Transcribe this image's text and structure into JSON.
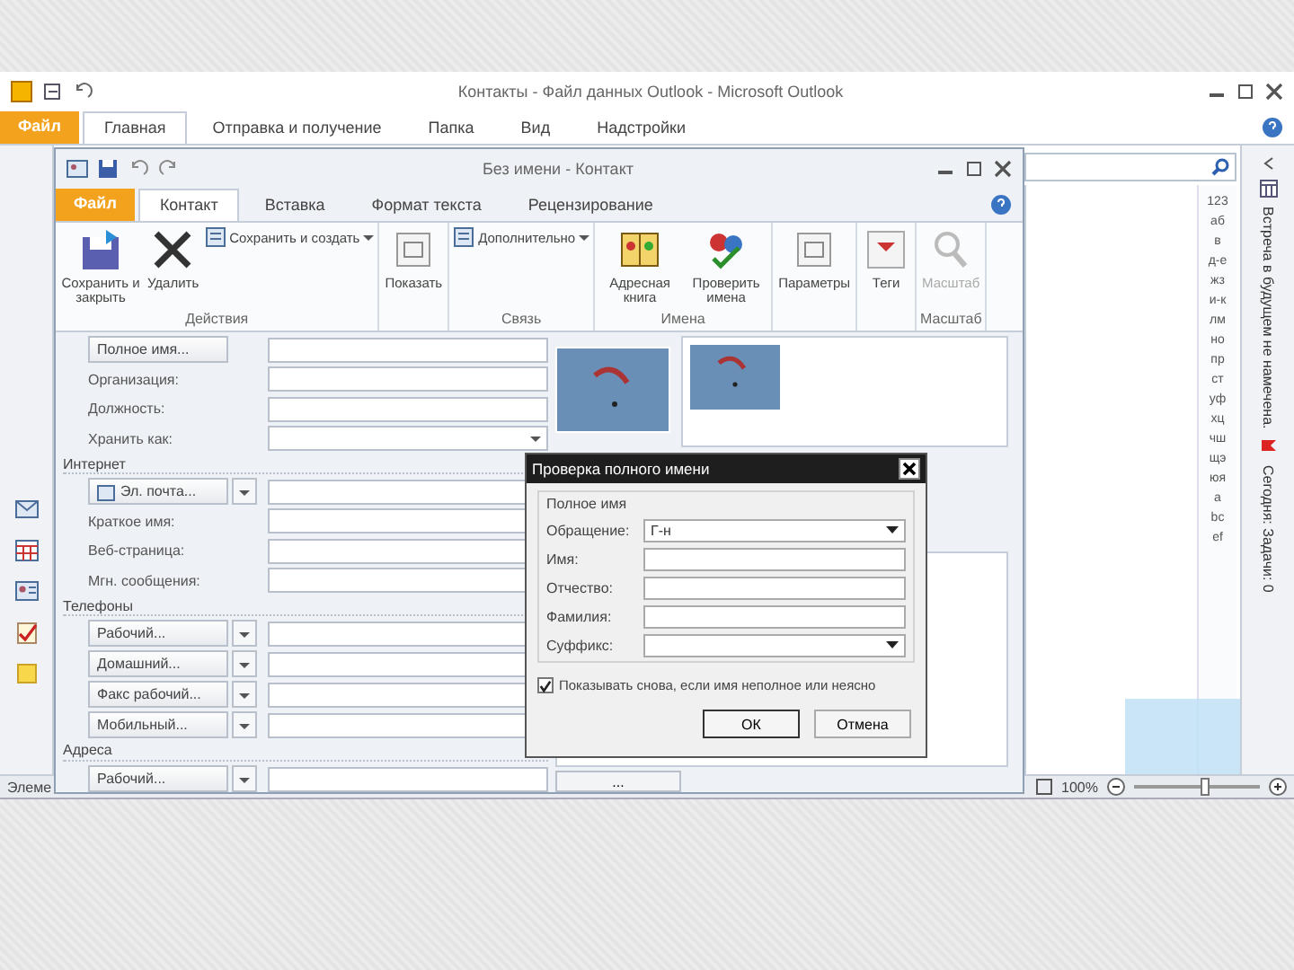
{
  "main_window": {
    "title": "Контакты - Файл данных Outlook - Microsoft Outlook",
    "menu_tabs": [
      {
        "label": "Файл",
        "selected": false,
        "kind": "file"
      },
      {
        "label": "Главная",
        "selected": true,
        "kind": "tab"
      },
      {
        "label": "Отправка и получение",
        "selected": false,
        "kind": "tab"
      },
      {
        "label": "Папка",
        "selected": false,
        "kind": "tab"
      },
      {
        "label": "Вид",
        "selected": false,
        "kind": "tab"
      },
      {
        "label": "Надстройки",
        "selected": false,
        "kind": "tab"
      }
    ],
    "status_text": "Элеме",
    "zoom_label": "100%",
    "zoom": {
      "level": 0.55
    }
  },
  "index_letters": [
    "123",
    "аб",
    "в",
    "д-е",
    "жз",
    "и-к",
    "лм",
    "но",
    "пр",
    "ст",
    "уф",
    "хц",
    "чш",
    "щэ",
    "юя",
    "a",
    "bc",
    "ef"
  ],
  "todo_bar": {
    "appointments": "Встреча в будущем не намечена.",
    "tasks": "Сегодня: Задачи: 0"
  },
  "contact_window": {
    "title": "Без имени - Контакт",
    "tabs": [
      {
        "label": "Файл",
        "selected": false,
        "kind": "file"
      },
      {
        "label": "Контакт",
        "selected": true,
        "kind": "tab"
      },
      {
        "label": "Вставка",
        "selected": false,
        "kind": "tab"
      },
      {
        "label": "Формат текста",
        "selected": false,
        "kind": "tab"
      },
      {
        "label": "Рецензирование",
        "selected": false,
        "kind": "tab"
      }
    ],
    "ribbon_groups": [
      {
        "label": "Действия",
        "buttons": [
          {
            "label": "Сохранить и закрыть",
            "kind": "save"
          },
          {
            "label": "Удалить",
            "kind": "delete"
          },
          {
            "label": "Сохранить и создать",
            "kind": "small"
          }
        ]
      },
      {
        "buttons": [
          {
            "label": "Показать",
            "kind": "show"
          }
        ]
      },
      {
        "label": "Связь",
        "buttons": [
          {
            "label": "Дополнительно",
            "kind": "small"
          }
        ]
      },
      {
        "label": "Имена",
        "buttons": [
          {
            "label": "Адресная книга",
            "kind": "book"
          },
          {
            "label": "Проверить имена",
            "kind": "check"
          }
        ]
      },
      {
        "buttons": [
          {
            "label": "Параметры",
            "kind": "show"
          }
        ]
      },
      {
        "buttons": [
          {
            "label": "Теги",
            "kind": "tags"
          }
        ]
      },
      {
        "label": "Масштаб",
        "buttons": [
          {
            "label": "Масштаб",
            "kind": "zoom",
            "disabled": true
          }
        ]
      }
    ],
    "form": [
      {
        "rows": [
          {
            "label": "Полное имя...",
            "kind": "button"
          },
          {
            "label": "Организация:",
            "kind": "label"
          },
          {
            "label": "Должность:",
            "kind": "label"
          },
          {
            "label": "Хранить как:",
            "kind": "combo"
          }
        ]
      },
      {
        "heading": "Интернет",
        "rows": [
          {
            "label": "Эл. почта...",
            "kind": "email"
          },
          {
            "label": "Краткое имя:",
            "kind": "label"
          },
          {
            "label": "Веб-страница:",
            "kind": "label"
          },
          {
            "label": "Мгн. сообщения:",
            "kind": "label"
          }
        ]
      },
      {
        "heading": "Телефоны",
        "rows": [
          {
            "label": "Рабочий...",
            "kind": "split"
          },
          {
            "label": "Домашний...",
            "kind": "split"
          },
          {
            "label": "Факс рабочий...",
            "kind": "split"
          },
          {
            "label": "Мобильный...",
            "kind": "split"
          }
        ]
      },
      {
        "heading": "Адреса",
        "rows": [
          {
            "label": "Рабочий...",
            "kind": "split"
          }
        ]
      }
    ],
    "notes_button": "..."
  },
  "dialog": {
    "title": "Проверка полного имени",
    "group": "Полное имя",
    "fields": [
      {
        "label": "Обращение:",
        "value": "Г-н",
        "kind": "combo"
      },
      {
        "label": "Имя:",
        "kind": "text"
      },
      {
        "label": "Отчество:",
        "kind": "text"
      },
      {
        "label": "Фамилия:",
        "kind": "text"
      },
      {
        "label": "Суффикс:",
        "kind": "combo"
      }
    ],
    "show_again": {
      "label": "Показывать снова, если имя неполное или неясно",
      "checked": true
    },
    "buttons": [
      {
        "label": "ОК",
        "selected": true
      },
      {
        "label": "Отмена",
        "selected": false
      }
    ]
  }
}
